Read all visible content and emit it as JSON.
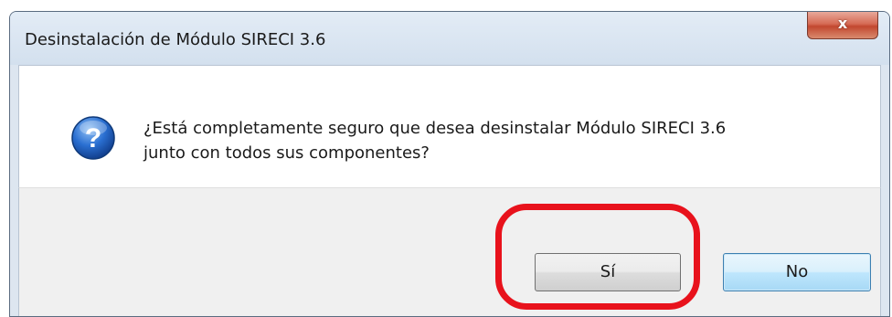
{
  "dialog": {
    "title": "Desinstalación de Módulo SIRECI 3.6",
    "close_glyph": "x",
    "message_line1": "¿Está completamente seguro que desea desinstalar Módulo SIRECI 3.6",
    "message_line2": "junto con todos sus componentes?",
    "icon": "question-icon"
  },
  "buttons": {
    "yes_label": "Sí",
    "no_label": "No"
  },
  "colors": {
    "highlight": "#e8121c",
    "titlebar": "#d3e0ee",
    "icon_blue": "#2a6fd1"
  }
}
